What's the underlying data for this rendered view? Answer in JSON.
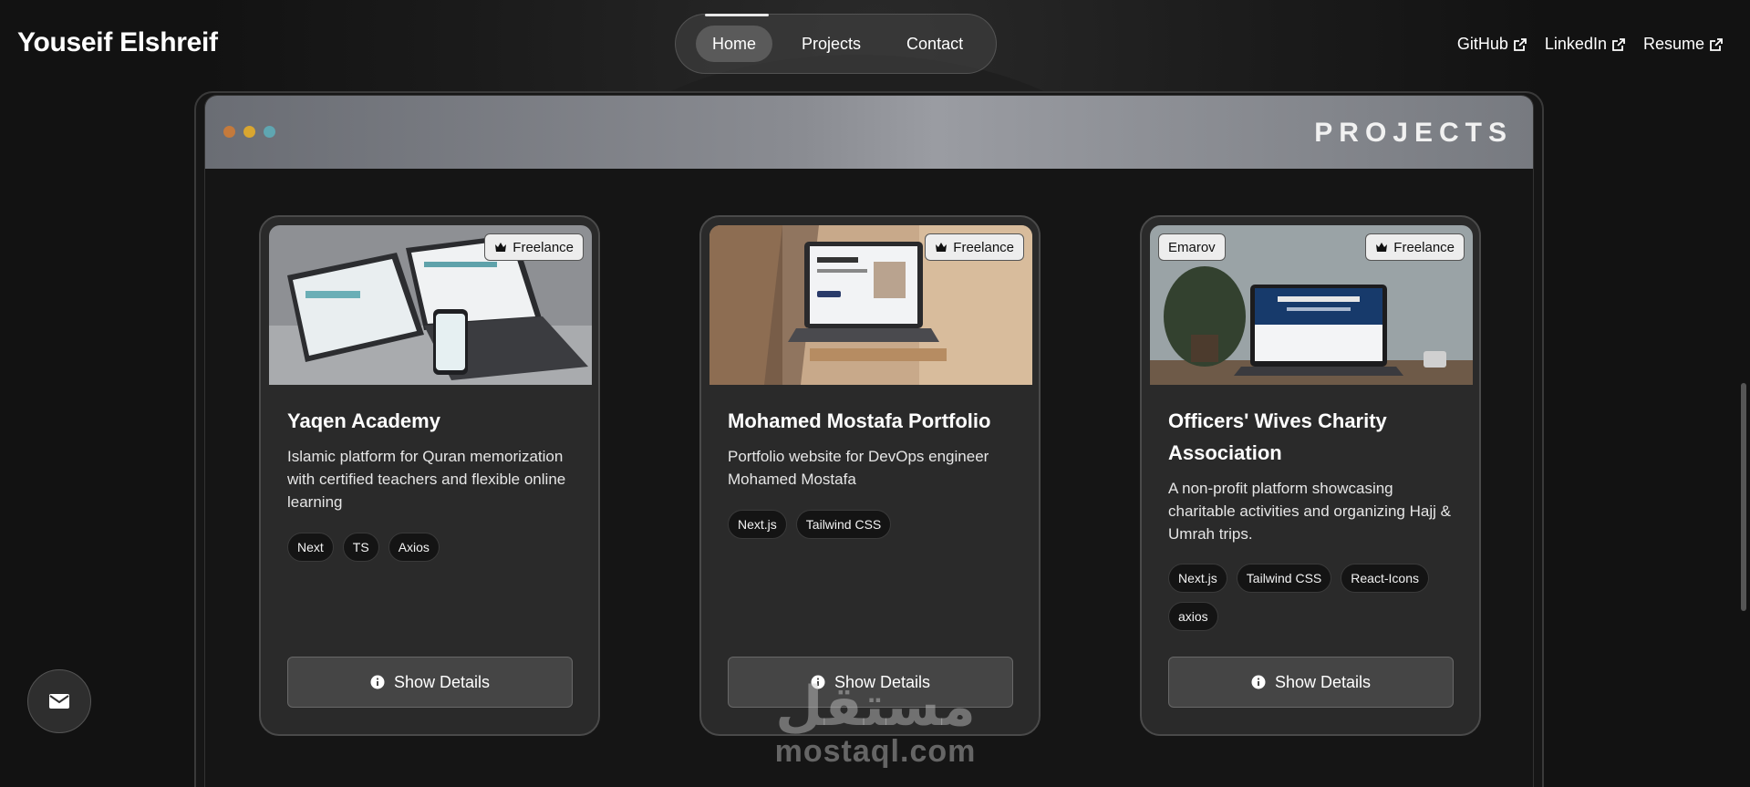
{
  "brand": {
    "name": "Youseif Elshreif"
  },
  "nav": {
    "items": [
      {
        "label": "Home",
        "active": true
      },
      {
        "label": "Projects",
        "active": false
      },
      {
        "label": "Contact",
        "active": false
      }
    ]
  },
  "external_links": [
    {
      "label": "GitHub",
      "icon": "external-link-icon"
    },
    {
      "label": "LinkedIn",
      "icon": "external-link-icon"
    },
    {
      "label": "Resume",
      "icon": "external-link-icon"
    }
  ],
  "window": {
    "title": "PROJECTS",
    "dots": [
      "#c47a3c",
      "#d9a630",
      "#5fa6b1"
    ]
  },
  "projects": [
    {
      "title": "Yaqen Academy",
      "description": "Islamic platform for Quran memorization with certified teachers and flexible online learning",
      "badges": [
        {
          "label": "Freelance",
          "icon": "crown-icon",
          "side": "right"
        }
      ],
      "tags": [
        "Next",
        "TS",
        "Axios"
      ],
      "button": "Show Details"
    },
    {
      "title": "Mohamed Mostafa Portfolio",
      "description": "Portfolio website for DevOps engineer Mohamed Mostafa",
      "badges": [
        {
          "label": "Freelance",
          "icon": "crown-icon",
          "side": "right"
        }
      ],
      "tags": [
        "Next.js",
        "Tailwind CSS"
      ],
      "button": "Show Details"
    },
    {
      "title": "Officers' Wives Charity Association",
      "description": "A non-profit platform showcasing charitable activities and organizing Hajj & Umrah trips.",
      "badges": [
        {
          "label": "Emarov",
          "icon": "",
          "side": "left"
        },
        {
          "label": "Freelance",
          "icon": "crown-icon",
          "side": "right"
        }
      ],
      "tags": [
        "Next.js",
        "Tailwind CSS",
        "React-Icons",
        "axios"
      ],
      "button": "Show Details"
    }
  ],
  "mail_fab": {
    "icon": "envelope-icon"
  },
  "watermark": {
    "arabic": "مستقل",
    "latin": "mostaql.com"
  },
  "colors": {
    "background": "#121212",
    "card": "#2a2a2a",
    "accent": "#ededed"
  }
}
